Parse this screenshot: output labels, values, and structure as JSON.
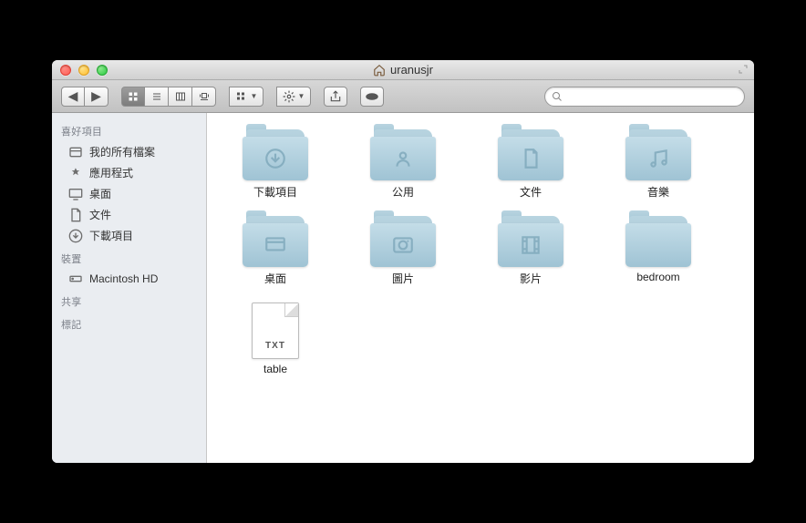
{
  "window": {
    "title": "uranusjr"
  },
  "search": {
    "placeholder": ""
  },
  "sidebar": {
    "sections": [
      {
        "title": "喜好項目",
        "items": [
          {
            "label": "我的所有檔案",
            "icon": "all-files-icon"
          },
          {
            "label": "應用程式",
            "icon": "applications-icon"
          },
          {
            "label": "桌面",
            "icon": "desktop-icon"
          },
          {
            "label": "文件",
            "icon": "documents-icon"
          },
          {
            "label": "下載項目",
            "icon": "downloads-icon"
          }
        ]
      },
      {
        "title": "裝置",
        "items": [
          {
            "label": "Macintosh HD",
            "icon": "hdd-icon"
          }
        ]
      },
      {
        "title": "共享",
        "items": []
      },
      {
        "title": "標記",
        "items": []
      }
    ]
  },
  "items": [
    {
      "label": "下載項目",
      "type": "folder",
      "glyph": "downloads"
    },
    {
      "label": "公用",
      "type": "folder",
      "glyph": "public"
    },
    {
      "label": "文件",
      "type": "folder",
      "glyph": "documents"
    },
    {
      "label": "音樂",
      "type": "folder",
      "glyph": "music"
    },
    {
      "label": "桌面",
      "type": "folder",
      "glyph": "desktop"
    },
    {
      "label": "圖片",
      "type": "folder",
      "glyph": "pictures"
    },
    {
      "label": "影片",
      "type": "folder",
      "glyph": "movies"
    },
    {
      "label": "bedroom",
      "type": "folder",
      "glyph": "generic"
    },
    {
      "label": "table",
      "type": "file",
      "ext": "TXT"
    }
  ]
}
